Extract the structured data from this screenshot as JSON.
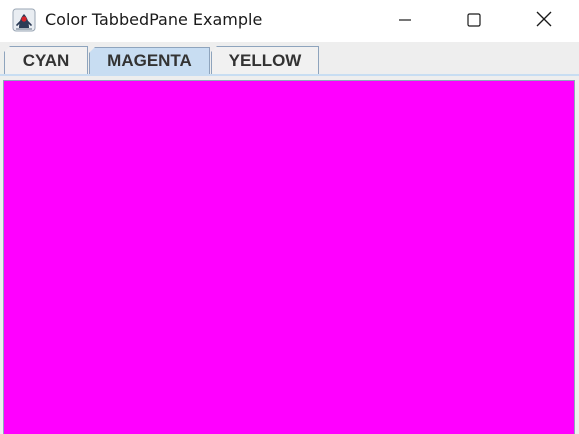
{
  "window": {
    "title": "Color TabbedPane Example",
    "app_icon": "java-duke-icon",
    "controls": {
      "minimize_icon": "minimize-icon",
      "maximize_icon": "maximize-icon",
      "close_icon": "close-icon"
    }
  },
  "tabs": [
    {
      "label": "CYAN",
      "selected": false
    },
    {
      "label": "MAGENTA",
      "selected": true
    },
    {
      "label": "YELLOW",
      "selected": false
    }
  ],
  "content": {
    "background_color": "#ff00ff"
  },
  "colors": {
    "selected_tab": "#c8ddf2",
    "tab_border": "#8ea4bd",
    "tab_background": "#f1f1f1",
    "tab_strip": "#eeeeee"
  }
}
